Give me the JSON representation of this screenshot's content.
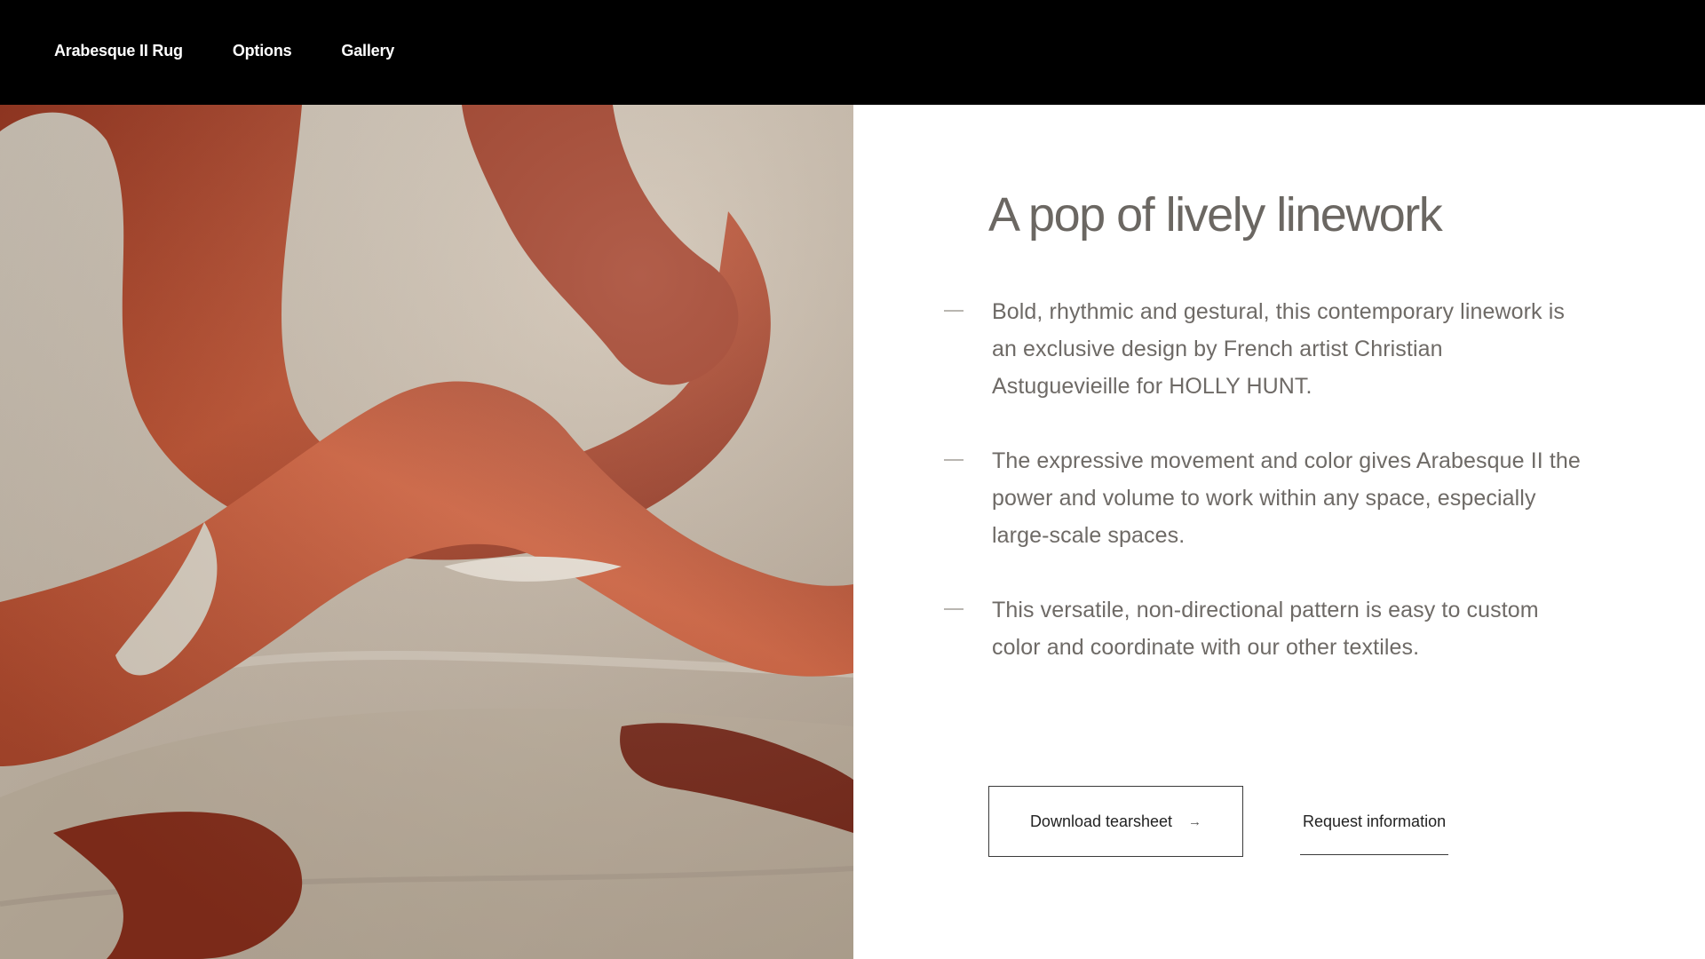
{
  "nav": {
    "items": [
      {
        "label": "Arabesque II Rug"
      },
      {
        "label": "Options"
      },
      {
        "label": "Gallery"
      }
    ]
  },
  "hero_image": {
    "subject": "close-up of rug with red-orange gestural linework on beige",
    "colors": {
      "base": "#cbbfae",
      "stroke": "#b24a2e",
      "stroke_light": "#d5623f",
      "stroke_dark": "#7d2a18"
    }
  },
  "main": {
    "headline": "A pop of lively linework",
    "bullets": [
      {
        "text": "Bold, rhythmic and gestural, this contemporary linework is an exclusive design by French artist Christian Astuguevieille for HOLLY HUNT."
      },
      {
        "text": "The expressive movement and color gives Arabesque II the power and volume to work within any space, especially large-scale spaces."
      },
      {
        "text": "This versatile, non-directional pattern is easy to custom color and coordinate with our other textiles."
      }
    ],
    "actions": {
      "download_label": "Download tearsheet",
      "download_arrow": "→",
      "request_label": "Request information"
    }
  }
}
